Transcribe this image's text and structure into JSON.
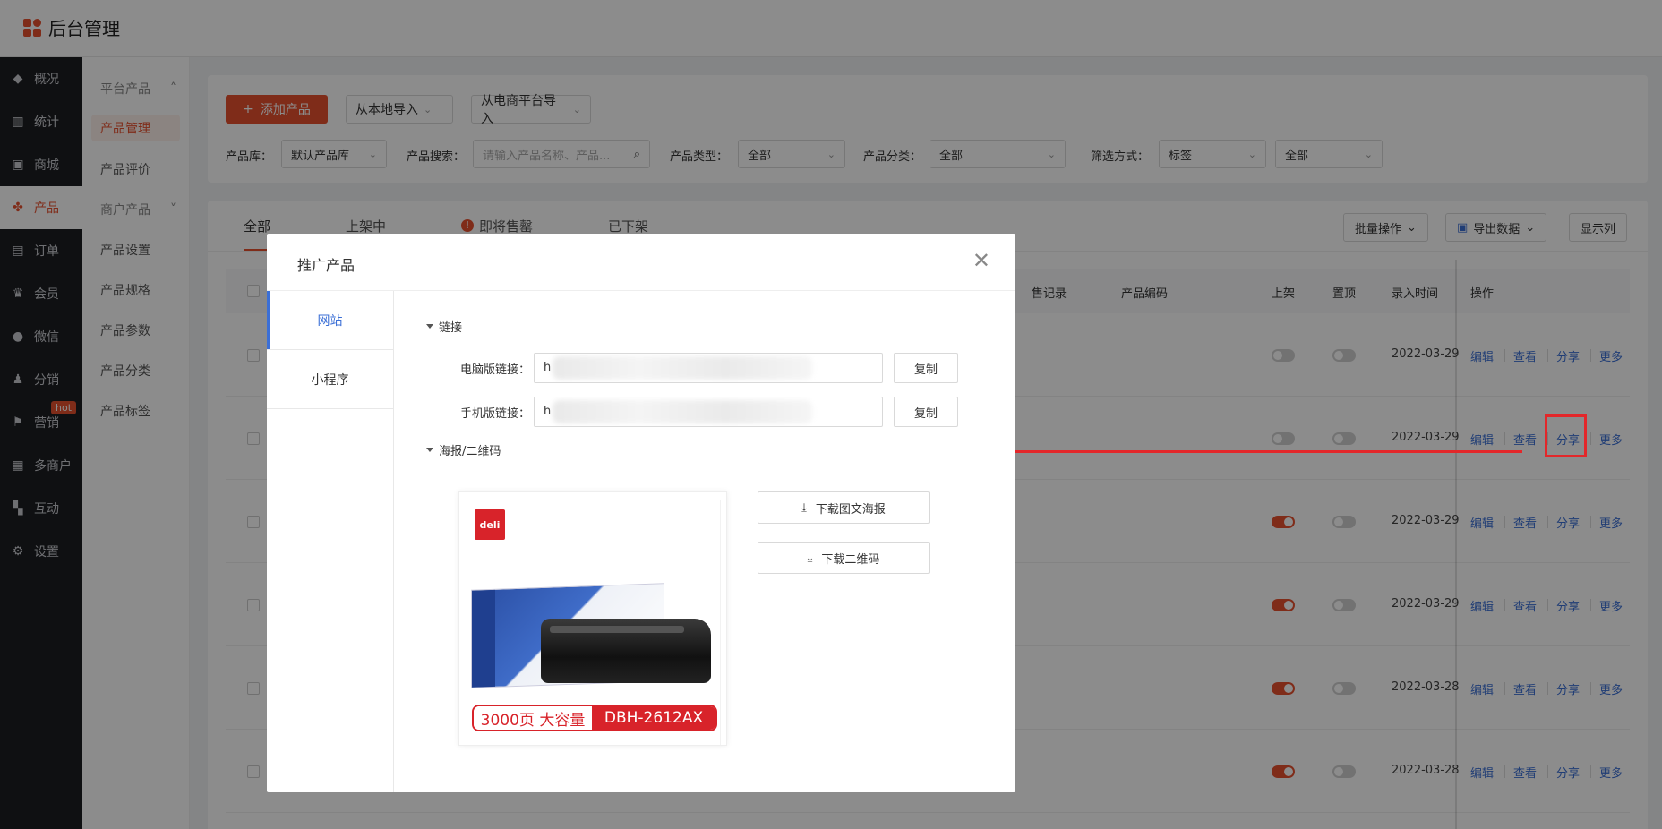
{
  "app": {
    "title": "后台管理"
  },
  "nav": [
    {
      "label": "概况",
      "icon": "layers-icon"
    },
    {
      "label": "统计",
      "icon": "chart-icon"
    },
    {
      "label": "商城",
      "icon": "store-icon"
    },
    {
      "label": "产品",
      "icon": "product-grid-icon"
    },
    {
      "label": "订单",
      "icon": "order-icon"
    },
    {
      "label": "会员",
      "icon": "crown-icon"
    },
    {
      "label": "微信",
      "icon": "wechat-icon"
    },
    {
      "label": "分销",
      "icon": "distribution-icon"
    },
    {
      "label": "营销",
      "icon": "flag-icon",
      "badge": "hot"
    },
    {
      "label": "多商户",
      "icon": "merchants-icon"
    },
    {
      "label": "互动",
      "icon": "interaction-icon"
    },
    {
      "label": "设置",
      "icon": "gear-icon"
    }
  ],
  "subnav": {
    "group1": "平台产品",
    "items1": [
      "产品管理",
      "产品评价"
    ],
    "group2": "商户产品",
    "items2": [
      "产品设置",
      "产品规格",
      "产品参数",
      "产品分类",
      "产品标签"
    ]
  },
  "toolbar": {
    "add_label": "添加产品",
    "import_local": "从本地导入",
    "import_ecom": "从电商平台导入"
  },
  "filters": {
    "library_label": "产品库：",
    "library_value": "默认产品库",
    "search_label": "产品搜索：",
    "search_placeholder": "请输入产品名称、产品...",
    "type_label": "产品类型：",
    "type_value": "全部",
    "category_label": "产品分类：",
    "category_value": "全部",
    "filter_label": "筛选方式：",
    "filter_value": "标签",
    "filter_value2": "全部"
  },
  "tabs": [
    "全部",
    "上架中",
    "即将售罄",
    "已下架"
  ],
  "list_actions": {
    "batch": "批量操作",
    "export": "导出数据",
    "columns": "显示列"
  },
  "table": {
    "headers": {
      "sales_record": "售记录",
      "code": "产品编码",
      "listed": "上架",
      "top": "置顶",
      "time": "录入时间",
      "ops": "操作"
    },
    "rows": [
      {
        "date": "2022-03-29",
        "listed": false,
        "top": false
      },
      {
        "date": "2022-03-29",
        "listed": false,
        "top": false
      },
      {
        "date": "2022-03-29",
        "listed": true,
        "top": false
      },
      {
        "date": "2022-03-29",
        "listed": true,
        "top": false
      },
      {
        "date": "2022-03-28",
        "listed": true,
        "top": false
      },
      {
        "date": "2022-03-28",
        "listed": true,
        "top": false
      }
    ],
    "ops": {
      "edit": "编辑",
      "view": "查看",
      "share": "分享",
      "more": "更多"
    }
  },
  "modal": {
    "title": "推广产品",
    "side_tabs": [
      "网站",
      "小程序"
    ],
    "link_section": "链接",
    "pc_label": "电脑版链接：",
    "mobile_label": "手机版链接：",
    "link_prefix": "h",
    "copy": "复制",
    "poster_section": "海报/二维码",
    "download_poster": "下载图文海报",
    "download_qr": "下载二维码",
    "poster": {
      "brand": "deli",
      "badge_left": "3000页 大容量",
      "badge_right": "DBH-2612AX"
    }
  },
  "colors": {
    "accent": "#e8502f",
    "link": "#3b6fd6",
    "annotation": "#e3272a"
  }
}
